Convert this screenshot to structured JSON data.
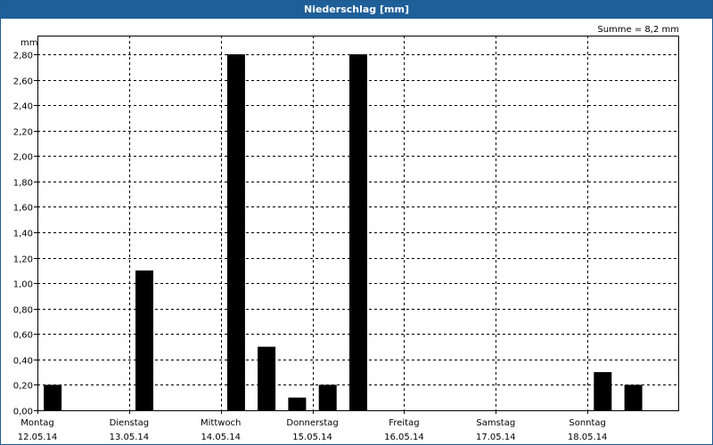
{
  "window": {
    "title": "Niederschlag [mm]",
    "sum_label": "Summe = 8,2 mm",
    "unit_label": "mm"
  },
  "colors": {
    "titlebar": "#1f5f99",
    "bar": "#000000",
    "grid": "#000000"
  },
  "chart_data": {
    "type": "bar",
    "title": "Niederschlag [mm]",
    "ylabel": "mm",
    "ylim": [
      0,
      2.9
    ],
    "grid": true,
    "y_ticks": [
      "0,00",
      "0,20",
      "0,40",
      "0,60",
      "0,80",
      "1,00",
      "1,20",
      "1,40",
      "1,60",
      "1,80",
      "2,00",
      "2,20",
      "2,40",
      "2,60",
      "2,80"
    ],
    "days": [
      {
        "name": "Montag",
        "date": "12.05.14"
      },
      {
        "name": "Dienstag",
        "date": "13.05.14"
      },
      {
        "name": "Mittwoch",
        "date": "14.05.14"
      },
      {
        "name": "Donnerstag",
        "date": "15.05.14"
      },
      {
        "name": "Freitag",
        "date": "16.05.14"
      },
      {
        "name": "Samstag",
        "date": "17.05.14"
      },
      {
        "name": "Sonntag",
        "date": "18.05.14"
      }
    ],
    "series": [
      {
        "values": [
          {
            "day": 0,
            "time": "00:00",
            "value": 0.2
          },
          {
            "day": 1,
            "time": "00:00",
            "value": 1.1
          },
          {
            "day": 2,
            "time": "00:00",
            "value": 2.8
          },
          {
            "day": 2,
            "time": "08:00",
            "value": 0.5
          },
          {
            "day": 2,
            "time": "16:00",
            "value": 0.1
          },
          {
            "day": 3,
            "time": "00:00",
            "value": 0.2
          },
          {
            "day": 3,
            "time": "08:00",
            "value": 2.8
          },
          {
            "day": 6,
            "time": "00:00",
            "value": 0.3
          },
          {
            "day": 6,
            "time": "08:00",
            "value": 0.2
          }
        ]
      }
    ]
  }
}
